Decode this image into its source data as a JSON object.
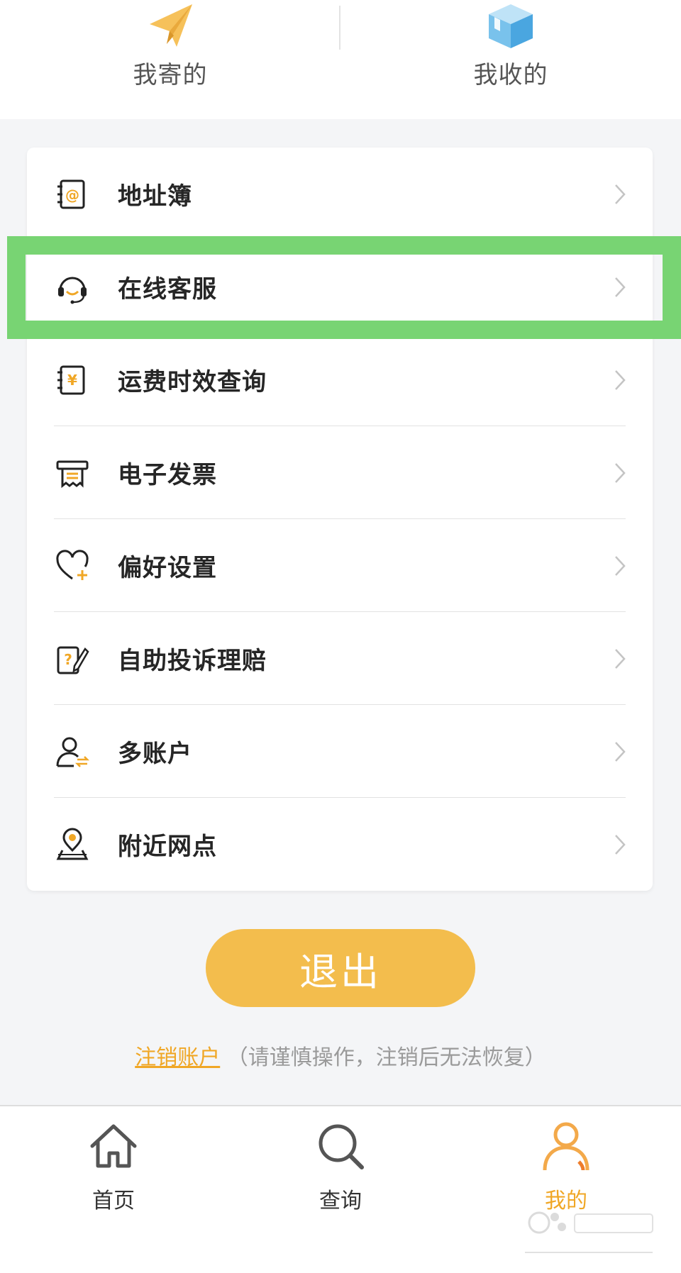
{
  "top": {
    "sent": {
      "label": "我寄的",
      "icon": "paper-plane-icon"
    },
    "received": {
      "label": "我收的",
      "icon": "package-box-icon"
    }
  },
  "menu": {
    "items": [
      {
        "label": "地址簿",
        "icon": "address-book-icon"
      },
      {
        "label": "在线客服",
        "icon": "headset-icon",
        "highlighted": true
      },
      {
        "label": "运费时效查询",
        "icon": "price-ledger-icon"
      },
      {
        "label": "电子发票",
        "icon": "receipt-printer-icon"
      },
      {
        "label": "偏好设置",
        "icon": "heart-plus-icon"
      },
      {
        "label": "自助投诉理赔",
        "icon": "question-note-pen-icon"
      },
      {
        "label": "多账户",
        "icon": "user-switch-icon"
      },
      {
        "label": "附近网点",
        "icon": "location-pin-icon"
      }
    ]
  },
  "logout": {
    "label": "退出"
  },
  "cancel_account": {
    "link": "注销账户",
    "note": "（请谨慎操作，注销后无法恢复）"
  },
  "bottom_nav": {
    "items": [
      {
        "label": "首页",
        "icon": "home-icon"
      },
      {
        "label": "查询",
        "icon": "search-icon"
      },
      {
        "label": "我的",
        "icon": "user-icon",
        "active": true
      }
    ]
  },
  "colors": {
    "accent": "#f3bd4d",
    "accent_text": "#f0a726",
    "highlight_frame": "#78d473",
    "background": "#f4f5f7"
  }
}
